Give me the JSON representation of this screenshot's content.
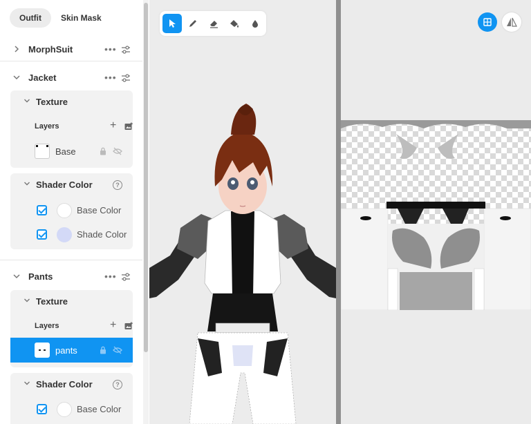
{
  "tabs": [
    {
      "label": "Outfit",
      "active": true
    },
    {
      "label": "Skin Mask",
      "active": false
    }
  ],
  "sections": {
    "morphsuit": {
      "title": "MorphSuit"
    },
    "jacket": {
      "title": "Jacket",
      "texture": {
        "title": "Texture",
        "layers_label": "Layers",
        "layers": [
          {
            "name": "Base"
          }
        ]
      },
      "shader": {
        "title": "Shader Color",
        "colors": [
          {
            "label": "Base Color",
            "checked": true,
            "color": "#ffffff"
          },
          {
            "label": "Shade Color",
            "checked": true,
            "color": "#d3d9f7"
          }
        ]
      }
    },
    "pants": {
      "title": "Pants",
      "texture": {
        "title": "Texture",
        "layers_label": "Layers",
        "layers": [
          {
            "name": "pants",
            "selected": true
          }
        ]
      },
      "shader": {
        "title": "Shader Color",
        "colors": [
          {
            "label": "Base Color",
            "checked": true,
            "color": "#ffffff"
          }
        ]
      }
    }
  },
  "toolbar": {
    "tools": [
      "select-tool",
      "pencil-tool",
      "eraser-tool",
      "fill-tool",
      "dropper-tool"
    ],
    "active": "select-tool"
  },
  "colors": {
    "accent": "#1094f2",
    "panel_card": "#f2f2f2",
    "viewport_bg": "#ececec",
    "splitter": "#8f8f8f"
  }
}
